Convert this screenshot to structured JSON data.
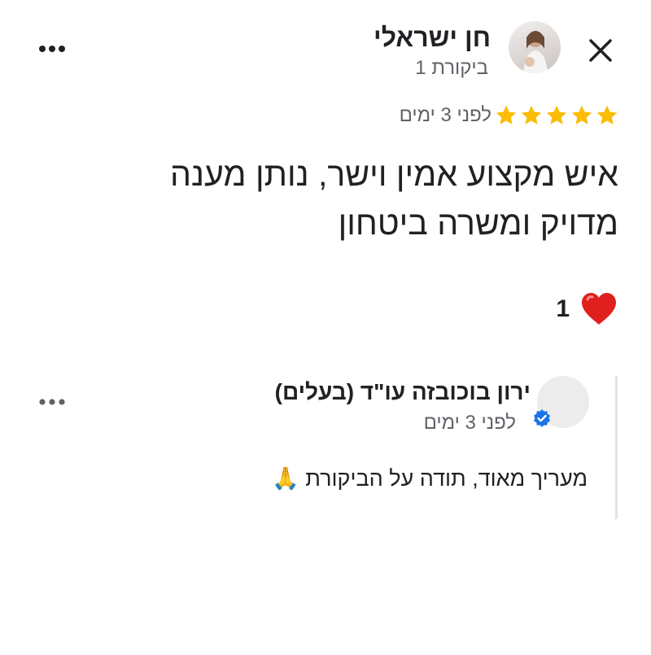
{
  "reviewer": {
    "name": "חן ישראלי",
    "review_count": "ביקורת 1",
    "avatar_icon": "user-photo"
  },
  "review": {
    "rating": 5,
    "rating_max": 5,
    "star_color": "#fbbc04",
    "date": "לפני 3 ימים",
    "text": "איש מקצוע אמין וישר, נותן מענה מדויק ומשרה ביטחון",
    "reaction": {
      "icon": "heart-icon",
      "count": "1"
    }
  },
  "owner_reply": {
    "name": "ירון בוכובזה עו\"ד (בעלים)",
    "date": "לפני 3 ימים",
    "text": "מעריך מאוד, תודה על הביקורת 🙏",
    "verified_color": "#1a73e8"
  }
}
